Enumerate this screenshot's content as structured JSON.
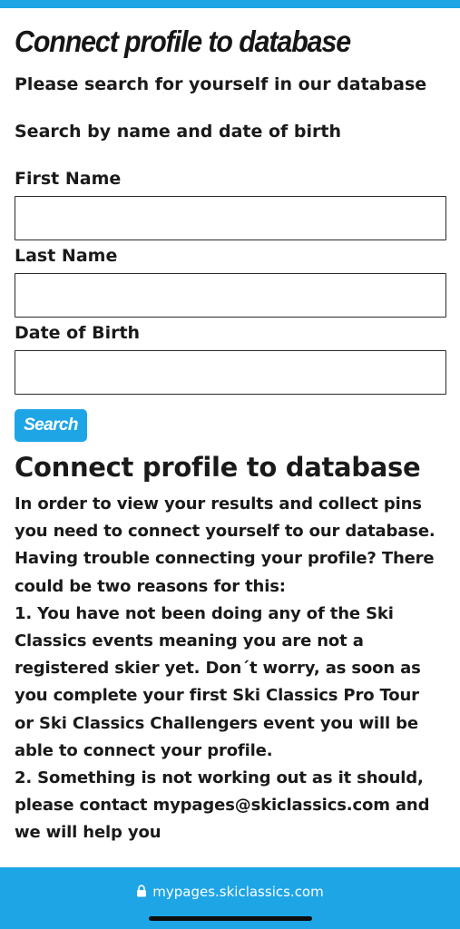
{
  "header": {
    "title": "Connect profile to database",
    "subtitle": "Please search for yourself in our database"
  },
  "search_form": {
    "instruction": "Search by name and date of birth",
    "fields": [
      {
        "label": "First Name",
        "value": "",
        "placeholder": ""
      },
      {
        "label": "Last Name",
        "value": "",
        "placeholder": ""
      },
      {
        "label": "Date of Birth",
        "value": "",
        "placeholder": ""
      }
    ],
    "search_button_label": "Search"
  },
  "info": {
    "title": "Connect profile to database",
    "lines": [
      "In order to view your results and collect pins",
      "you need to connect yourself to our database.",
      "Having trouble connecting your profile? There",
      "could be two reasons for this:",
      "1. You have not been doing any of the Ski",
      "Classics events meaning you are not a",
      "registered skier yet. Don´t worry, as soon as",
      "you complete your first Ski Classics Pro Tour",
      "or Ski Classics Challengers event you will be",
      "able to connect your profile.",
      "2. Something is not working out as it should,",
      "please contact mypages@skiclassics.com and",
      "we will help you"
    ]
  },
  "browser": {
    "url": "mypages.skiclassics.com",
    "lock_icon": "lock-icon"
  },
  "colors": {
    "accent": "#1ea5e6",
    "text": "#1a1a1a",
    "background": "#ffffff"
  }
}
